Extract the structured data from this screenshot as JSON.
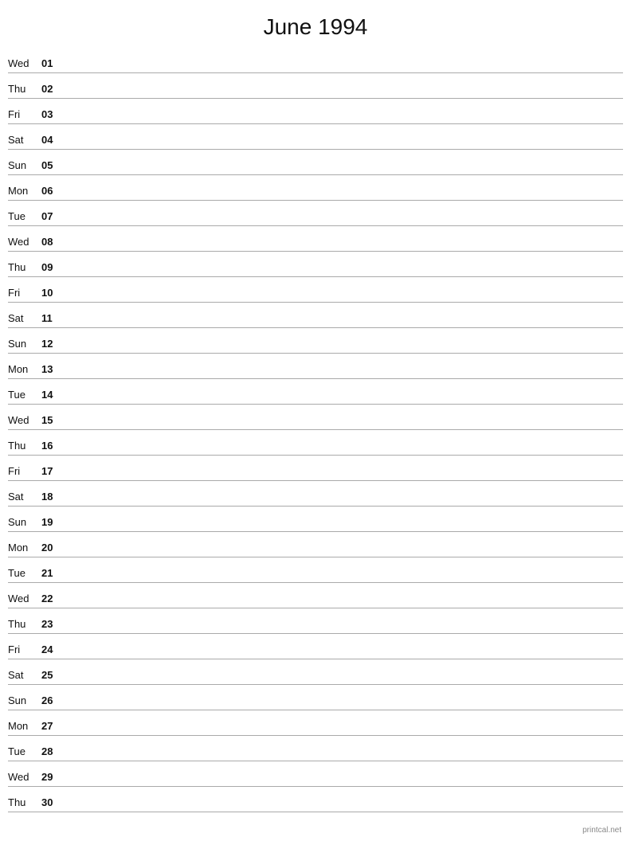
{
  "title": "June 1994",
  "footer": "printcal.net",
  "days": [
    {
      "name": "Wed",
      "number": "01"
    },
    {
      "name": "Thu",
      "number": "02"
    },
    {
      "name": "Fri",
      "number": "03"
    },
    {
      "name": "Sat",
      "number": "04"
    },
    {
      "name": "Sun",
      "number": "05"
    },
    {
      "name": "Mon",
      "number": "06"
    },
    {
      "name": "Tue",
      "number": "07"
    },
    {
      "name": "Wed",
      "number": "08"
    },
    {
      "name": "Thu",
      "number": "09"
    },
    {
      "name": "Fri",
      "number": "10"
    },
    {
      "name": "Sat",
      "number": "11"
    },
    {
      "name": "Sun",
      "number": "12"
    },
    {
      "name": "Mon",
      "number": "13"
    },
    {
      "name": "Tue",
      "number": "14"
    },
    {
      "name": "Wed",
      "number": "15"
    },
    {
      "name": "Thu",
      "number": "16"
    },
    {
      "name": "Fri",
      "number": "17"
    },
    {
      "name": "Sat",
      "number": "18"
    },
    {
      "name": "Sun",
      "number": "19"
    },
    {
      "name": "Mon",
      "number": "20"
    },
    {
      "name": "Tue",
      "number": "21"
    },
    {
      "name": "Wed",
      "number": "22"
    },
    {
      "name": "Thu",
      "number": "23"
    },
    {
      "name": "Fri",
      "number": "24"
    },
    {
      "name": "Sat",
      "number": "25"
    },
    {
      "name": "Sun",
      "number": "26"
    },
    {
      "name": "Mon",
      "number": "27"
    },
    {
      "name": "Tue",
      "number": "28"
    },
    {
      "name": "Wed",
      "number": "29"
    },
    {
      "name": "Thu",
      "number": "30"
    }
  ]
}
